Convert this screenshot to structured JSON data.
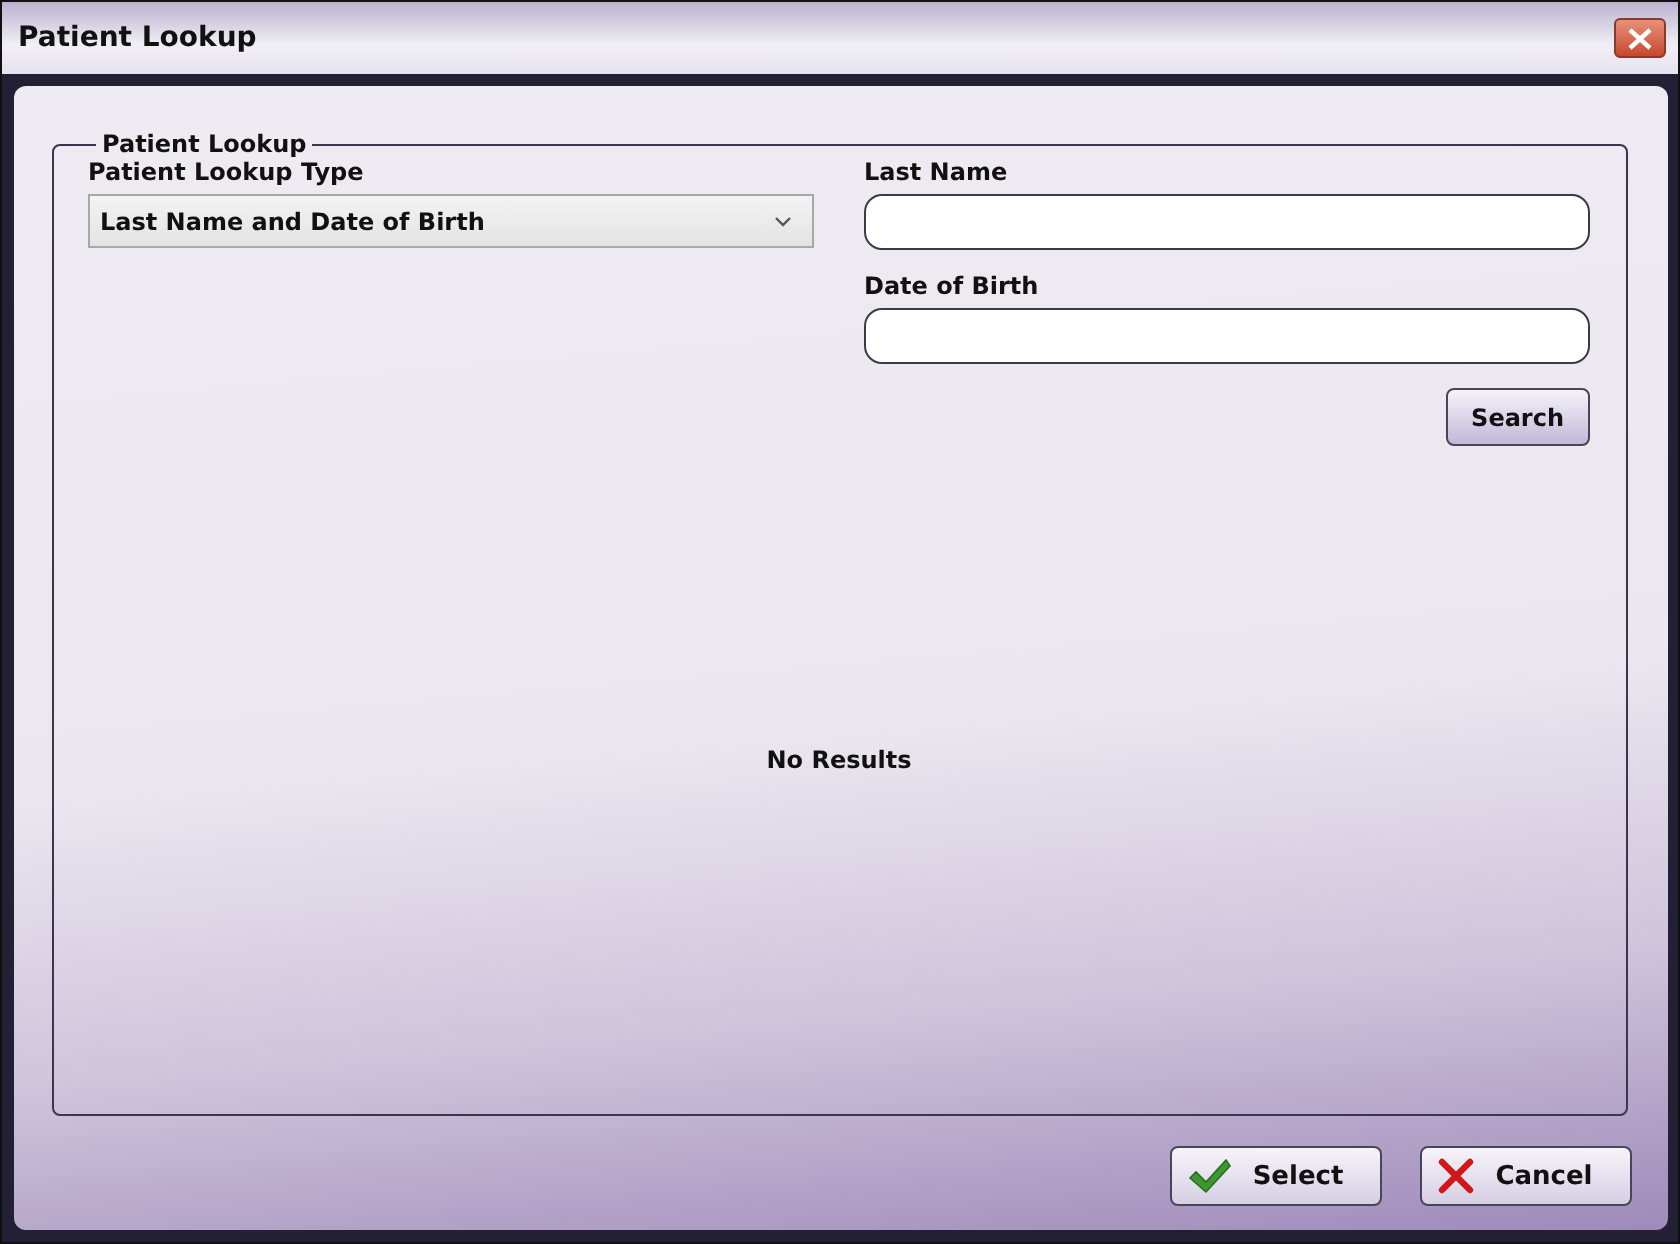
{
  "window": {
    "title": "Patient Lookup"
  },
  "group": {
    "title": "Patient Lookup"
  },
  "lookup_type": {
    "label": "Patient Lookup Type",
    "value": "Last Name and Date of Birth"
  },
  "fields": [
    {
      "label": "Last Name"
    },
    {
      "label": "Date of Birth"
    }
  ],
  "search_button": "Search",
  "results_message": "No Results",
  "buttons": [
    {
      "label": "Select",
      "kind": "confirm"
    },
    {
      "label": "Cancel",
      "kind": "cancel"
    }
  ]
}
